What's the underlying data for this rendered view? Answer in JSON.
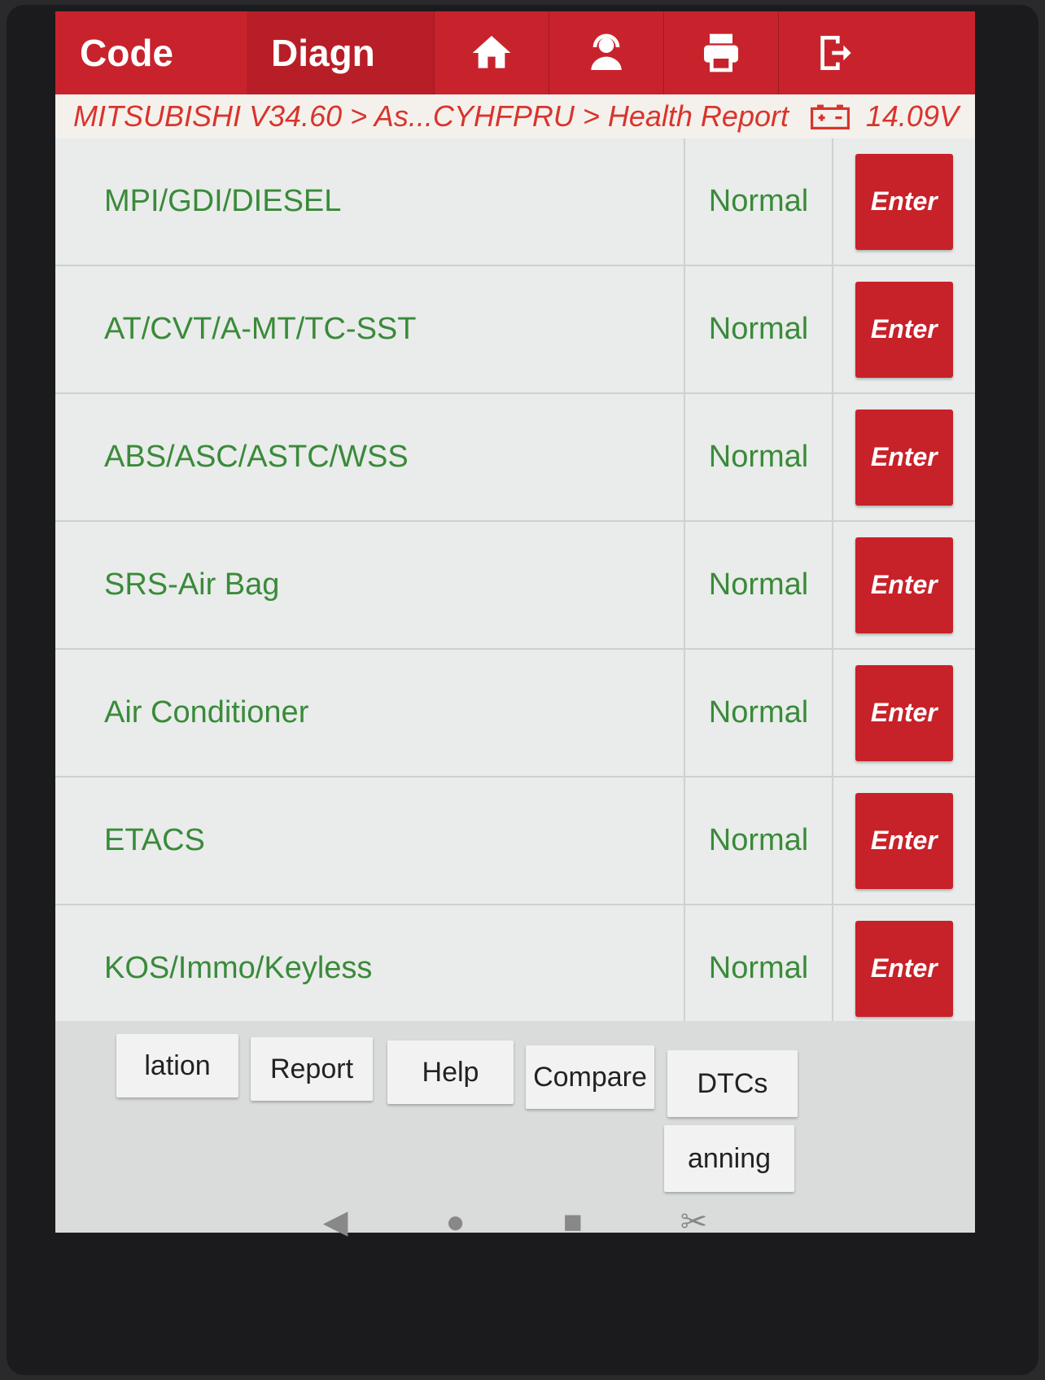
{
  "header": {
    "tab_code": "Code",
    "tab_diagnose": "Diagn",
    "icons": [
      "home-icon",
      "support-agent-icon",
      "printer-icon",
      "exit-icon"
    ]
  },
  "breadcrumb": {
    "path": "MITSUBISHI V34.60 > As...CYHFPRU > Health Report",
    "voltage": "14.09V"
  },
  "systems": [
    {
      "name": "MPI/GDI/DIESEL",
      "status": "Normal",
      "action": "Enter"
    },
    {
      "name": "AT/CVT/A-MT/TC-SST",
      "status": "Normal",
      "action": "Enter"
    },
    {
      "name": "ABS/ASC/ASTC/WSS",
      "status": "Normal",
      "action": "Enter"
    },
    {
      "name": "SRS-Air Bag",
      "status": "Normal",
      "action": "Enter"
    },
    {
      "name": "Air Conditioner",
      "status": "Normal",
      "action": "Enter"
    },
    {
      "name": "ETACS",
      "status": "Normal",
      "action": "Enter"
    },
    {
      "name": "KOS/Immo/Keyless",
      "status": "Normal",
      "action": "Enter"
    }
  ],
  "bottom_buttons": {
    "b1": "lation",
    "b2": "Report",
    "b3": "Help",
    "b4": "Compare",
    "b5": "DTCs",
    "b6": "anning"
  },
  "colors": {
    "brand_red": "#c8232c",
    "status_green": "#3a8a3a"
  }
}
